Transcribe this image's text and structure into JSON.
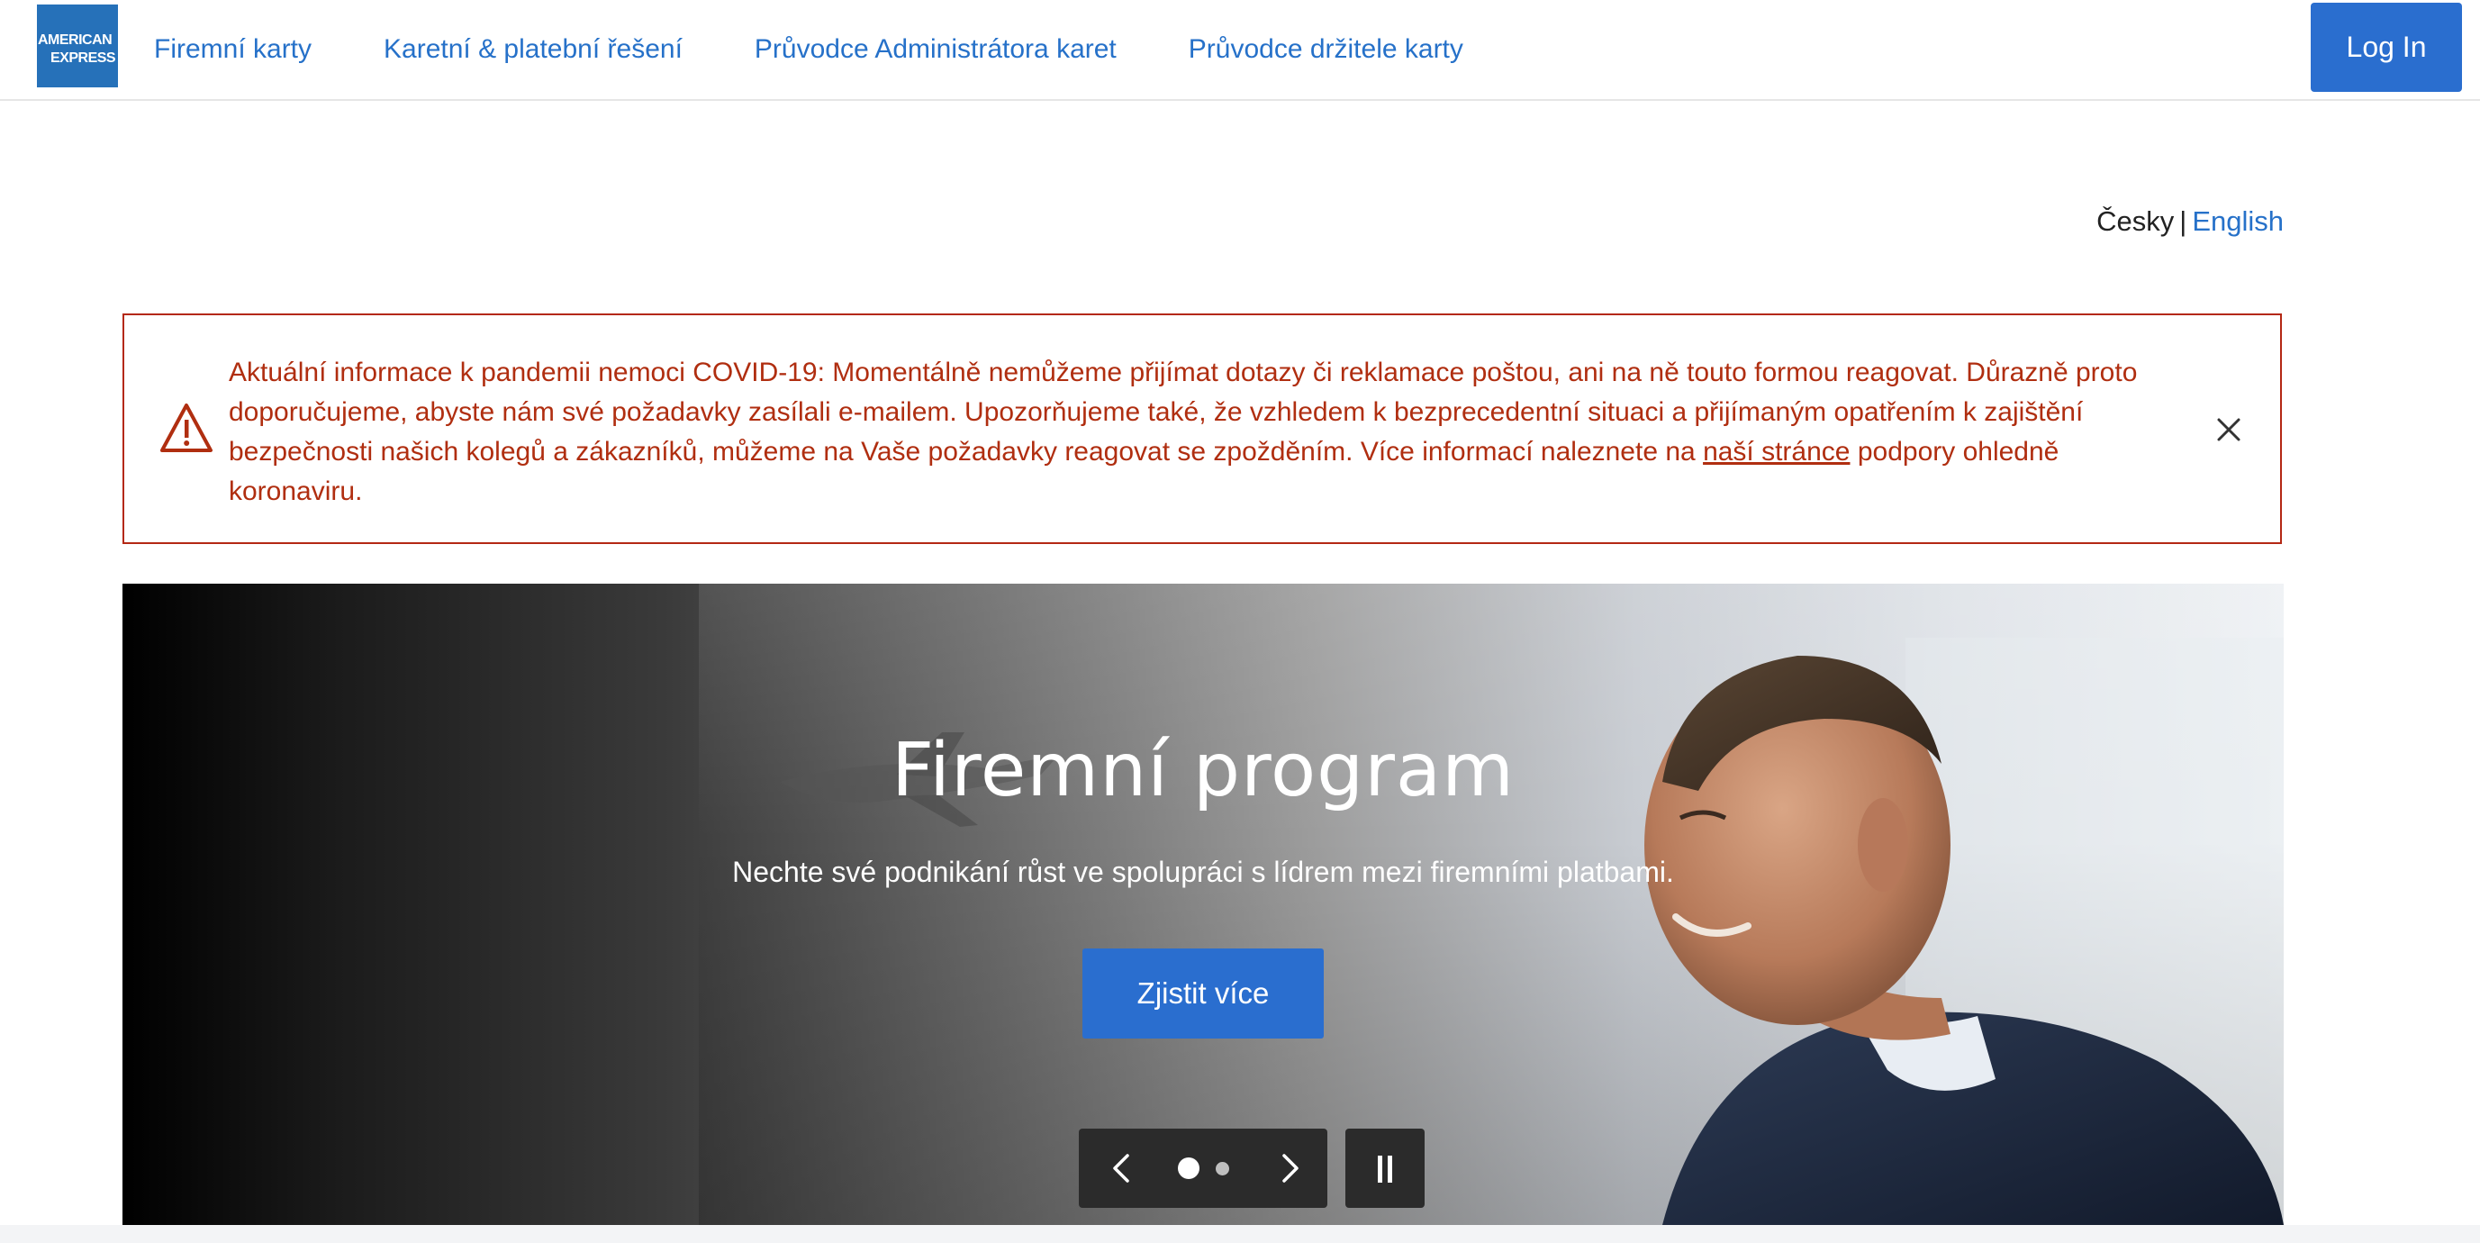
{
  "header": {
    "logo_line1": "AMERICAN",
    "logo_line2": "EXPRESS",
    "nav": [
      {
        "label": "Firemní karty"
      },
      {
        "label": "Karetní & platební řešení"
      },
      {
        "label": "Průvodce Administrátora karet"
      },
      {
        "label": "Průvodce držitele karty"
      }
    ],
    "login_label": "Log In"
  },
  "language": {
    "current": "Česky",
    "separator": "|",
    "other": "English"
  },
  "alert": {
    "text_before_link": "Aktuální informace k pandemii nemoci COVID-19: Momentálně nemůžeme přijímat dotazy či reklamace poštou, ani na ně touto formou reagovat. Důrazně proto doporučujeme, abyste nám své požadavky zasílali e-mailem. Upozorňujeme také, že vzhledem k bezprecedentní situaci a přijímaným opatřením k zajištění bezpečnosti našich kolegů a zákazníků, můžeme na Vaše požadavky reagovat se zpožděním. Více informací naleznete na",
    "link_text": "naší stránce",
    "text_after_link": "podpory ohledně koronaviru."
  },
  "hero": {
    "title": "Firemní program",
    "subtitle": "Nechte své podnikání růst ve spolupráci s lídrem mezi firemními platbami.",
    "cta_label": "Zjistit více",
    "slides_total": 2,
    "active_slide": 1
  },
  "colors": {
    "brand_blue": "#2a6ecf",
    "link_blue": "#2671c9",
    "alert_red": "#b42814"
  }
}
